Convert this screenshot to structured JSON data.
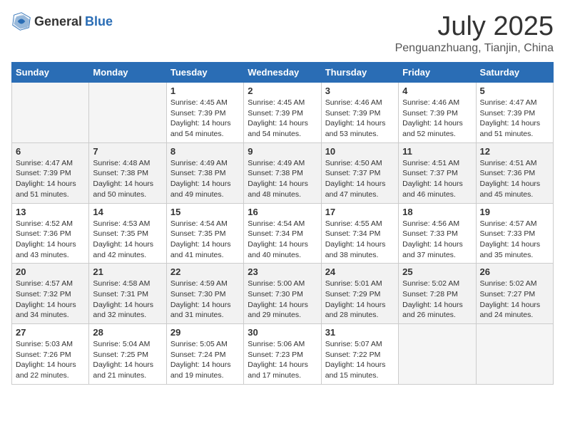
{
  "logo": {
    "general": "General",
    "blue": "Blue"
  },
  "header": {
    "month": "July 2025",
    "location": "Penguanzhuang, Tianjin, China"
  },
  "weekdays": [
    "Sunday",
    "Monday",
    "Tuesday",
    "Wednesday",
    "Thursday",
    "Friday",
    "Saturday"
  ],
  "weeks": [
    {
      "days": [
        {
          "empty": true
        },
        {
          "empty": true
        },
        {
          "num": "1",
          "sunrise": "4:45 AM",
          "sunset": "7:39 PM",
          "daylight": "14 hours and 54 minutes."
        },
        {
          "num": "2",
          "sunrise": "4:45 AM",
          "sunset": "7:39 PM",
          "daylight": "14 hours and 54 minutes."
        },
        {
          "num": "3",
          "sunrise": "4:46 AM",
          "sunset": "7:39 PM",
          "daylight": "14 hours and 53 minutes."
        },
        {
          "num": "4",
          "sunrise": "4:46 AM",
          "sunset": "7:39 PM",
          "daylight": "14 hours and 52 minutes."
        },
        {
          "num": "5",
          "sunrise": "4:47 AM",
          "sunset": "7:39 PM",
          "daylight": "14 hours and 51 minutes."
        }
      ]
    },
    {
      "days": [
        {
          "num": "6",
          "sunrise": "4:47 AM",
          "sunset": "7:39 PM",
          "daylight": "14 hours and 51 minutes."
        },
        {
          "num": "7",
          "sunrise": "4:48 AM",
          "sunset": "7:38 PM",
          "daylight": "14 hours and 50 minutes."
        },
        {
          "num": "8",
          "sunrise": "4:49 AM",
          "sunset": "7:38 PM",
          "daylight": "14 hours and 49 minutes."
        },
        {
          "num": "9",
          "sunrise": "4:49 AM",
          "sunset": "7:38 PM",
          "daylight": "14 hours and 48 minutes."
        },
        {
          "num": "10",
          "sunrise": "4:50 AM",
          "sunset": "7:37 PM",
          "daylight": "14 hours and 47 minutes."
        },
        {
          "num": "11",
          "sunrise": "4:51 AM",
          "sunset": "7:37 PM",
          "daylight": "14 hours and 46 minutes."
        },
        {
          "num": "12",
          "sunrise": "4:51 AM",
          "sunset": "7:36 PM",
          "daylight": "14 hours and 45 minutes."
        }
      ]
    },
    {
      "days": [
        {
          "num": "13",
          "sunrise": "4:52 AM",
          "sunset": "7:36 PM",
          "daylight": "14 hours and 43 minutes."
        },
        {
          "num": "14",
          "sunrise": "4:53 AM",
          "sunset": "7:35 PM",
          "daylight": "14 hours and 42 minutes."
        },
        {
          "num": "15",
          "sunrise": "4:54 AM",
          "sunset": "7:35 PM",
          "daylight": "14 hours and 41 minutes."
        },
        {
          "num": "16",
          "sunrise": "4:54 AM",
          "sunset": "7:34 PM",
          "daylight": "14 hours and 40 minutes."
        },
        {
          "num": "17",
          "sunrise": "4:55 AM",
          "sunset": "7:34 PM",
          "daylight": "14 hours and 38 minutes."
        },
        {
          "num": "18",
          "sunrise": "4:56 AM",
          "sunset": "7:33 PM",
          "daylight": "14 hours and 37 minutes."
        },
        {
          "num": "19",
          "sunrise": "4:57 AM",
          "sunset": "7:33 PM",
          "daylight": "14 hours and 35 minutes."
        }
      ]
    },
    {
      "days": [
        {
          "num": "20",
          "sunrise": "4:57 AM",
          "sunset": "7:32 PM",
          "daylight": "14 hours and 34 minutes."
        },
        {
          "num": "21",
          "sunrise": "4:58 AM",
          "sunset": "7:31 PM",
          "daylight": "14 hours and 32 minutes."
        },
        {
          "num": "22",
          "sunrise": "4:59 AM",
          "sunset": "7:30 PM",
          "daylight": "14 hours and 31 minutes."
        },
        {
          "num": "23",
          "sunrise": "5:00 AM",
          "sunset": "7:30 PM",
          "daylight": "14 hours and 29 minutes."
        },
        {
          "num": "24",
          "sunrise": "5:01 AM",
          "sunset": "7:29 PM",
          "daylight": "14 hours and 28 minutes."
        },
        {
          "num": "25",
          "sunrise": "5:02 AM",
          "sunset": "7:28 PM",
          "daylight": "14 hours and 26 minutes."
        },
        {
          "num": "26",
          "sunrise": "5:02 AM",
          "sunset": "7:27 PM",
          "daylight": "14 hours and 24 minutes."
        }
      ]
    },
    {
      "days": [
        {
          "num": "27",
          "sunrise": "5:03 AM",
          "sunset": "7:26 PM",
          "daylight": "14 hours and 22 minutes."
        },
        {
          "num": "28",
          "sunrise": "5:04 AM",
          "sunset": "7:25 PM",
          "daylight": "14 hours and 21 minutes."
        },
        {
          "num": "29",
          "sunrise": "5:05 AM",
          "sunset": "7:24 PM",
          "daylight": "14 hours and 19 minutes."
        },
        {
          "num": "30",
          "sunrise": "5:06 AM",
          "sunset": "7:23 PM",
          "daylight": "14 hours and 17 minutes."
        },
        {
          "num": "31",
          "sunrise": "5:07 AM",
          "sunset": "7:22 PM",
          "daylight": "14 hours and 15 minutes."
        },
        {
          "empty": true
        },
        {
          "empty": true
        }
      ]
    }
  ]
}
